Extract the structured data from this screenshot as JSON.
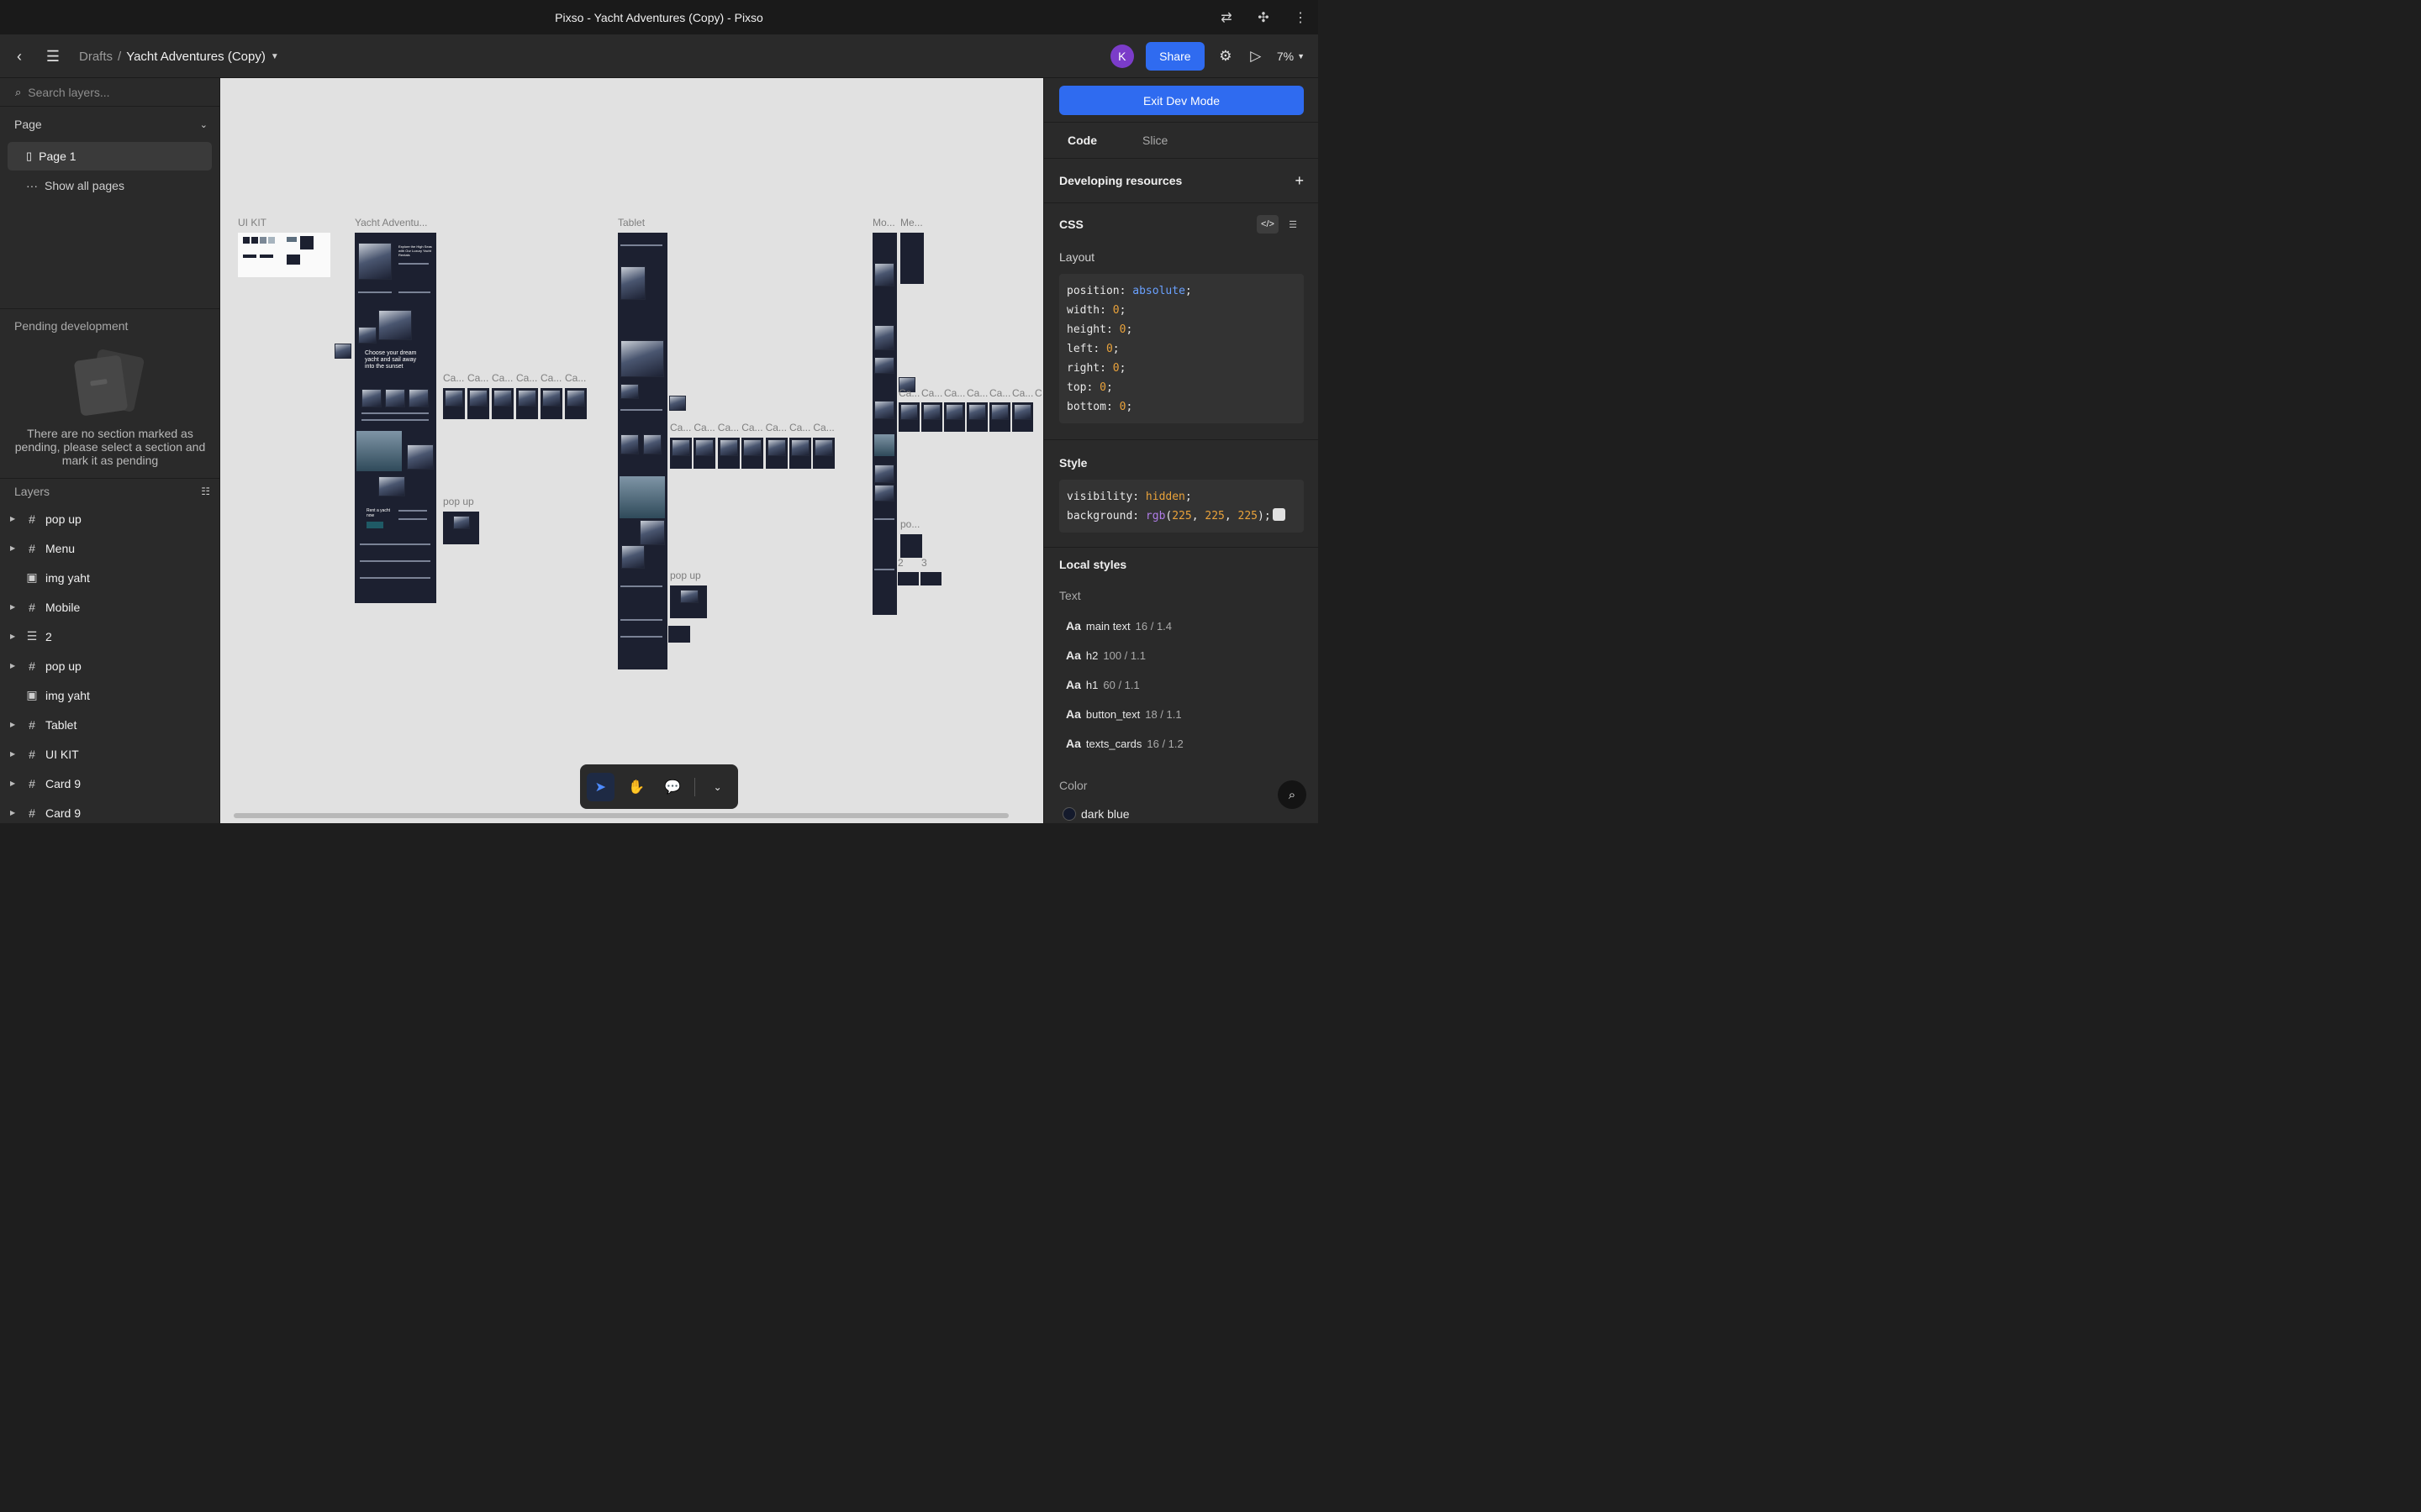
{
  "window": {
    "title": "Pixso - Yacht Adventures (Copy) - Pixso"
  },
  "toolbar": {
    "breadcrumb_root": "Drafts",
    "breadcrumb_sep": "/",
    "file_name": "Yacht Adventures (Copy)",
    "avatar_initial": "K",
    "share_label": "Share",
    "zoom": "7%"
  },
  "left": {
    "search_placeholder": "Search layers...",
    "page_section": "Page",
    "current_page": "Page 1",
    "show_all_pages": "Show all pages",
    "pending_title": "Pending development",
    "pending_message": "There are no section marked as pending, please select a section and mark it as pending",
    "layers_title": "Layers",
    "layers": [
      {
        "name": "pop up",
        "type": "frame",
        "expandable": true
      },
      {
        "name": "Menu",
        "type": "frame",
        "expandable": true
      },
      {
        "name": "img yaht",
        "type": "image",
        "expandable": false
      },
      {
        "name": "Mobile",
        "type": "frame",
        "expandable": true
      },
      {
        "name": "2",
        "type": "group",
        "expandable": true
      },
      {
        "name": "pop up",
        "type": "frame",
        "expandable": true
      },
      {
        "name": "img yaht",
        "type": "image",
        "expandable": false
      },
      {
        "name": "Tablet",
        "type": "frame",
        "expandable": true
      },
      {
        "name": "UI KIT",
        "type": "frame",
        "expandable": true
      },
      {
        "name": "Card 9",
        "type": "frame",
        "expandable": true
      },
      {
        "name": "Card 9",
        "type": "frame",
        "expandable": true
      }
    ]
  },
  "canvas": {
    "labels": {
      "ui_kit": "UI KIT",
      "yacht": "Yacht Adventu...",
      "tablet": "Tablet",
      "mobile": "Mo...",
      "menu": "Me...",
      "card": "Ca...",
      "popup": "pop up",
      "popup_short": "po...",
      "num2": "2",
      "num3": "3",
      "card_cut": "C"
    },
    "hero_text": "Explore the High Seas with Our Luxury Yacht Rentals",
    "choose_text": "Choose your dream yacht and sail away into the sunset",
    "rent_text": "Rent a yacht now"
  },
  "right": {
    "exit_dev_mode": "Exit Dev Mode",
    "tab_code": "Code",
    "tab_slice": "Slice",
    "developing_resources": "Developing resources",
    "css_title": "CSS",
    "layout_label": "Layout",
    "layout_css": [
      {
        "prop": "position",
        "value": "absolute",
        "kind": "kw"
      },
      {
        "prop": "width",
        "value": "0",
        "kind": "num"
      },
      {
        "prop": "height",
        "value": "0",
        "kind": "num"
      },
      {
        "prop": "left",
        "value": "0",
        "kind": "num"
      },
      {
        "prop": "right",
        "value": "0",
        "kind": "num"
      },
      {
        "prop": "top",
        "value": "0",
        "kind": "num"
      },
      {
        "prop": "bottom",
        "value": "0",
        "kind": "num"
      }
    ],
    "style_label": "Style",
    "style_visibility": "hidden",
    "style_bg_fn": "rgb",
    "style_bg_r": "225",
    "style_bg_g": "225",
    "style_bg_b": "225",
    "local_styles": "Local styles",
    "text_label": "Text",
    "text_styles": [
      {
        "name": "main text",
        "meta": "16 / 1.4"
      },
      {
        "name": "h2",
        "meta": "100 / 1.1"
      },
      {
        "name": "h1",
        "meta": "60 / 1.1"
      },
      {
        "name": "button_text",
        "meta": "18 / 1.1"
      },
      {
        "name": "texts_cards",
        "meta": "16 / 1.2"
      }
    ],
    "color_label": "Color",
    "color_name": "dark blue",
    "color_value": "#141a2c"
  },
  "colors": {
    "accent": "#2f6bf0",
    "canvas": "#e1e1e1",
    "panel": "#2a2a2a",
    "avatar": "#7b3cc9"
  }
}
